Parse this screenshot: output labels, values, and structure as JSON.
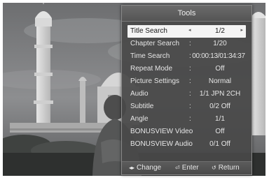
{
  "menu": {
    "title": "Tools",
    "rows": [
      {
        "label": "Title Search",
        "value": "1/2",
        "separator": ""
      },
      {
        "label": "Chapter Search",
        "value": "1/20",
        "separator": ":"
      },
      {
        "label": "Time Search",
        "value": "00:00:13/01:34:37",
        "separator": ":"
      },
      {
        "label": "Repeat Mode",
        "value": "Off",
        "separator": ":"
      },
      {
        "label": "Picture Settings",
        "value": "Normal",
        "separator": ":"
      },
      {
        "label": "Audio",
        "value": "1/1 JPN 2CH",
        "separator": ":"
      },
      {
        "label": "Subtitle",
        "value": "0/2 Off",
        "separator": ":"
      },
      {
        "label": "Angle",
        "value": "1/1",
        "separator": ":"
      },
      {
        "label": "BONUSVIEW Video",
        "value": "Off",
        "separator": ":"
      },
      {
        "label": "BONUSVIEW Audio",
        "value": "0/1 Off",
        "separator": ":"
      }
    ],
    "selected_index": 0,
    "footer": {
      "change": {
        "label": "Change",
        "icon": "left-right-arrows-icon",
        "glyph": "◂▸"
      },
      "enter": {
        "label": "Enter",
        "icon": "enter-icon",
        "glyph": "⏎"
      },
      "return": {
        "label": "Return",
        "icon": "return-icon",
        "glyph": "↺"
      }
    }
  },
  "colors": {
    "panel_bg": "#484848",
    "selected_bg": "#f4f4f4",
    "text": "#e6e6e6"
  }
}
